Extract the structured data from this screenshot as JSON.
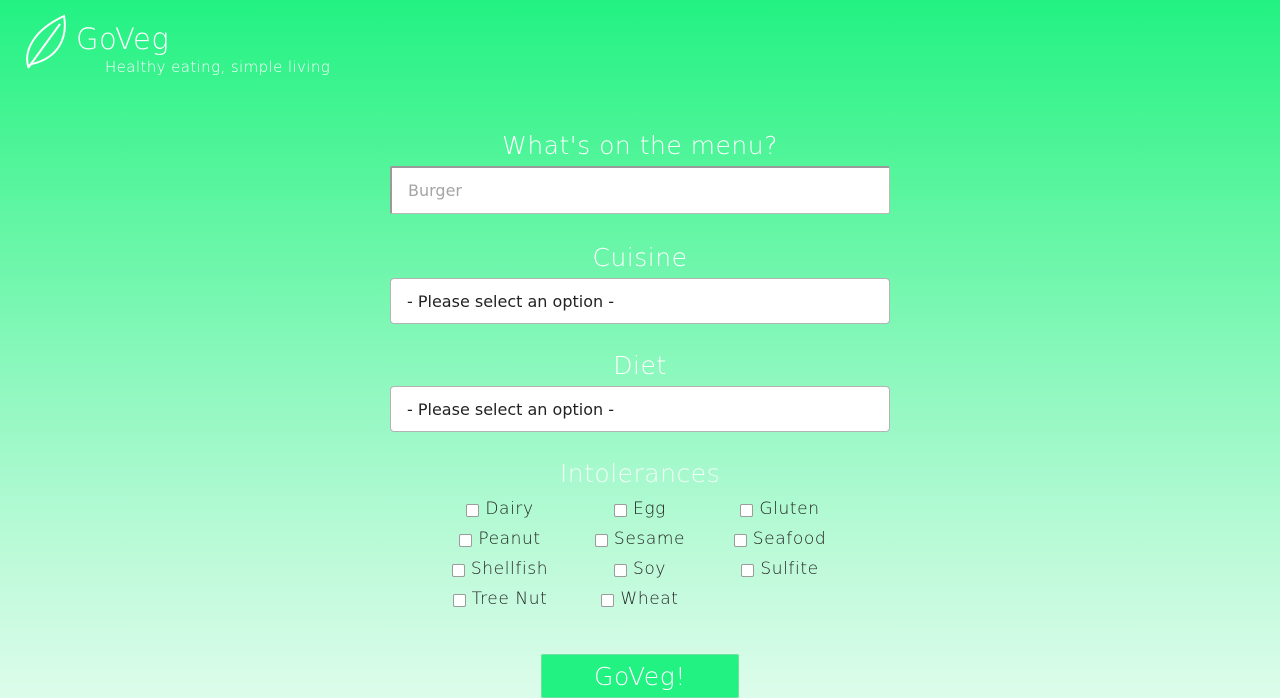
{
  "brand": {
    "name": "GoVeg",
    "tagline": "Healthy eating, simple living"
  },
  "menu": {
    "label": "What's on the menu?",
    "placeholder": "Burger",
    "value": ""
  },
  "cuisine": {
    "label": "Cuisine",
    "selected": "- Please select an option -"
  },
  "diet": {
    "label": "Diet",
    "selected": "- Please select an option -"
  },
  "intolerances": {
    "label": "Intolerances",
    "options": [
      [
        "Dairy",
        "Egg",
        "Gluten"
      ],
      [
        "Peanut",
        "Sesame",
        "Seafood"
      ],
      [
        "Shellfish",
        "Soy",
        "Sulfite"
      ],
      [
        "Tree Nut",
        "Wheat"
      ]
    ]
  },
  "submit": {
    "label": "GoVeg!"
  },
  "colors": {
    "accent": "#22f282",
    "text": "#ffffff"
  }
}
